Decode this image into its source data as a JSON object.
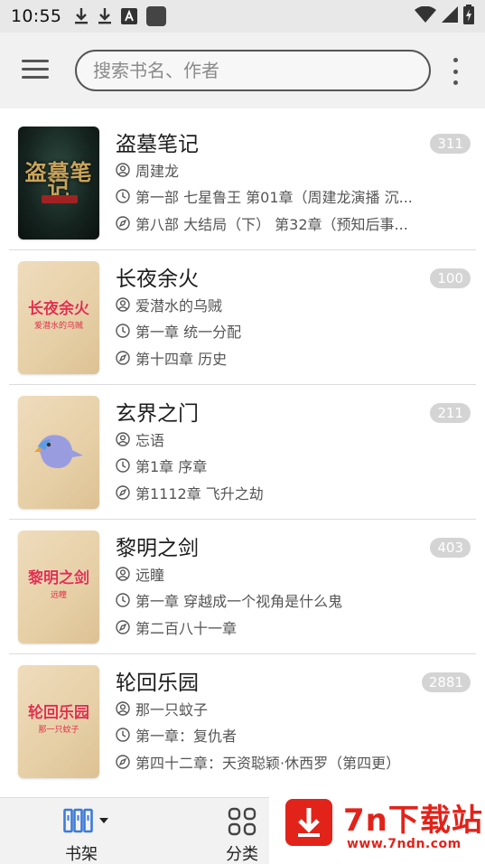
{
  "status_bar": {
    "time": "10:55"
  },
  "header": {
    "search_placeholder": "搜索书名、作者"
  },
  "books": [
    {
      "title": "盗墓笔记",
      "author": "周建龙",
      "last_read": "第一部 七星鲁王 第01章（周建龙演播 沉...",
      "latest": "第八部 大结局（下） 第32章（预知后事...",
      "count": "311",
      "cover_title": "盗墓笔记",
      "cover_sub": ""
    },
    {
      "title": "长夜余火",
      "author": "爱潜水的乌贼",
      "last_read": "第一章 统一分配",
      "latest": "第十四章 历史",
      "count": "100",
      "cover_title": "长夜余火",
      "cover_sub": "爱潜水的乌贼"
    },
    {
      "title": "玄界之门",
      "author": "忘语",
      "last_read": "第1章 序章",
      "latest": "第1112章 飞升之劫",
      "count": "211",
      "cover_title": "",
      "cover_sub": ""
    },
    {
      "title": "黎明之剑",
      "author": "远瞳",
      "last_read": "第一章 穿越成一个视角是什么鬼",
      "latest": "第二百八十一章",
      "count": "403",
      "cover_title": "黎明之剑",
      "cover_sub": "远瞳"
    },
    {
      "title": "轮回乐园",
      "author": "那一只蚊子",
      "last_read": "第一章：复仇者",
      "latest": "第四十二章：天资聪颖·休西罗（第四更）",
      "count": "2881",
      "cover_title": "轮回乐园",
      "cover_sub": "那一只蚊子"
    }
  ],
  "bottom_nav": {
    "shelf_label": "书架",
    "category_label": "分类"
  },
  "watermark": {
    "brand": "7n下载站",
    "url": "www.7ndn.com"
  },
  "colors": {
    "accent": "#3d7bd6",
    "badge": "#d4d4d4",
    "watermark": "#e2231a"
  }
}
